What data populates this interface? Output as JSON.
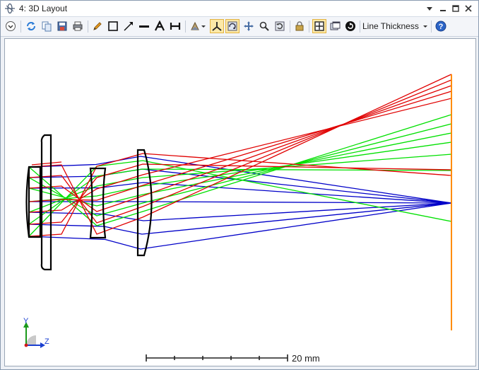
{
  "window": {
    "title": "4: 3D Layout"
  },
  "toolbar": {
    "buttons": [
      {
        "name": "settings-dropdown-icon"
      },
      {
        "name": "refresh-icon"
      },
      {
        "name": "copy-icon"
      },
      {
        "name": "save-icon"
      },
      {
        "name": "print-icon"
      },
      {
        "name": "pencil-icon"
      },
      {
        "name": "rectangle-icon"
      },
      {
        "name": "arrow-icon"
      },
      {
        "name": "line-icon"
      },
      {
        "name": "text-icon"
      },
      {
        "name": "dimension-icon"
      },
      {
        "name": "rotate-view-icon"
      },
      {
        "name": "axes-icon"
      },
      {
        "name": "orbit-icon"
      },
      {
        "name": "pan-icon"
      },
      {
        "name": "zoom-icon"
      },
      {
        "name": "reset-view-icon"
      },
      {
        "name": "lock-icon"
      },
      {
        "name": "fit-window-icon"
      },
      {
        "name": "new-window-icon"
      },
      {
        "name": "rotate-icon"
      },
      {
        "name": "help-icon"
      }
    ],
    "line_thickness_label": "Line Thickness"
  },
  "layout": {
    "scale_bar_label": "20 mm",
    "axis_labels": {
      "y": "Y",
      "z": "Z"
    },
    "ray_colors": {
      "field1": "#0000c8",
      "field2": "#00e000",
      "field3": "#e00000"
    },
    "image_plane_color": "#ff8c00",
    "lens_color": "#000000"
  }
}
